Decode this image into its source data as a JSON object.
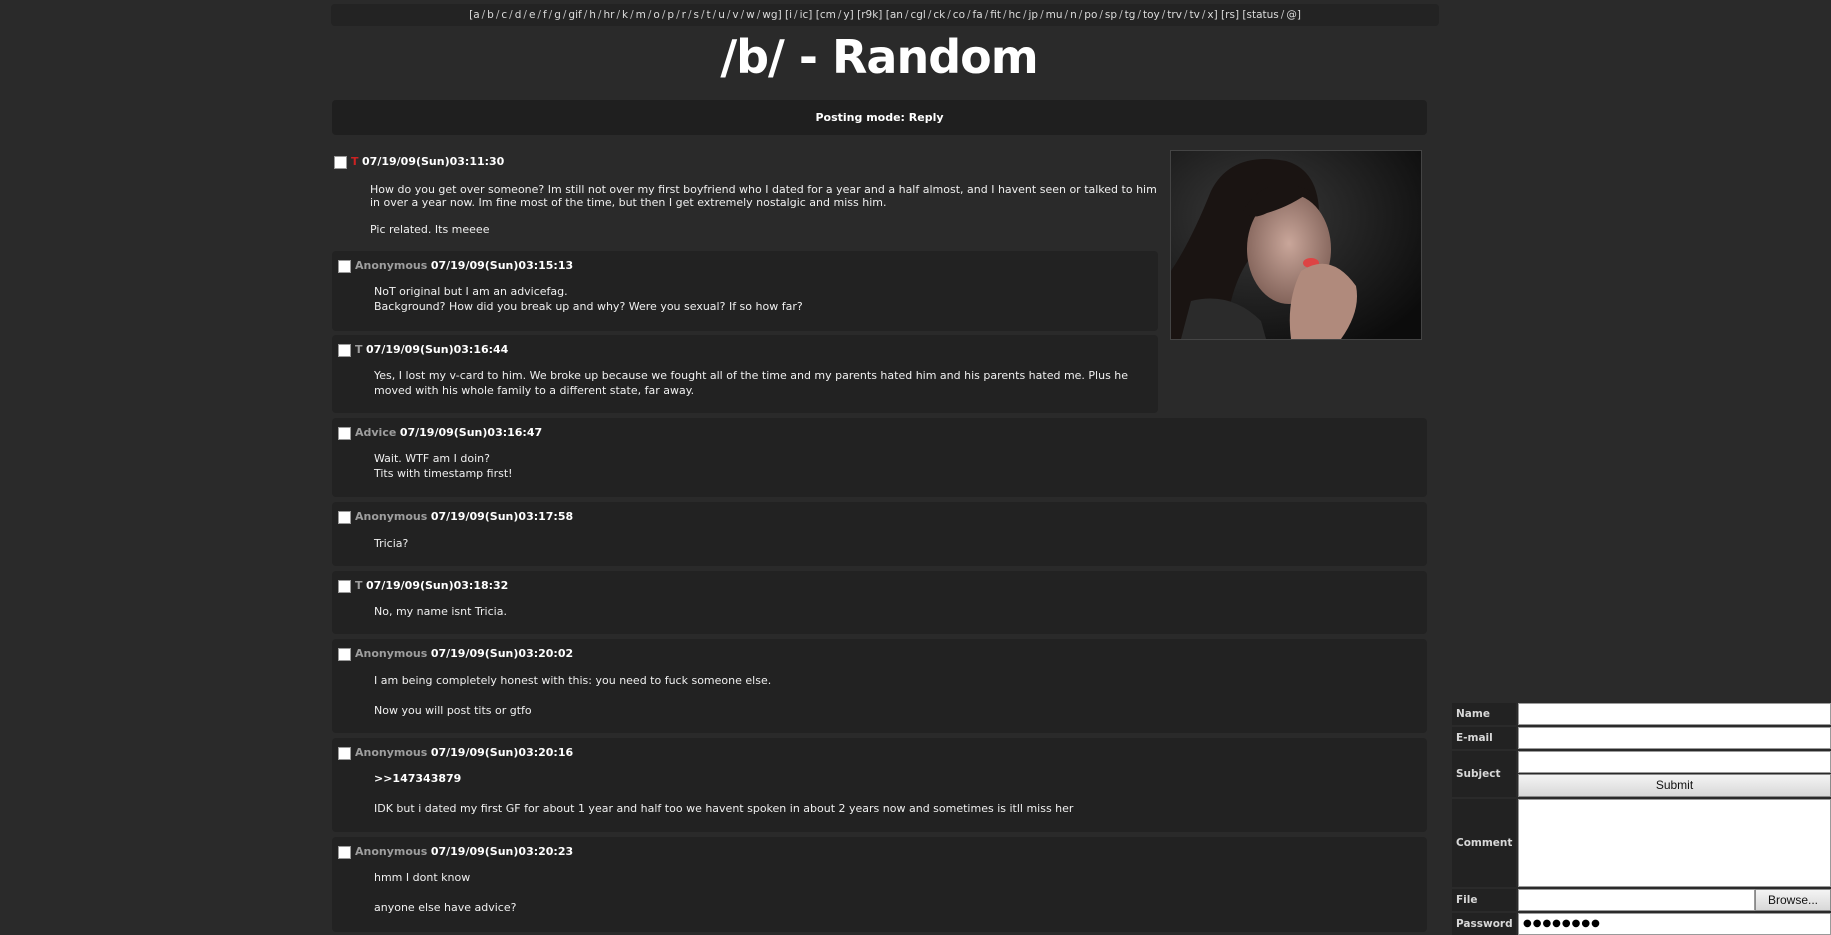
{
  "nav": {
    "groups": [
      [
        "a",
        "b",
        "c",
        "d",
        "e",
        "f",
        "g",
        "gif",
        "h",
        "hr",
        "k",
        "m",
        "o",
        "p",
        "r",
        "s",
        "t",
        "u",
        "v",
        "w",
        "wg"
      ],
      [
        "i",
        "ic"
      ],
      [
        "cm",
        "y"
      ],
      [
        "r9k"
      ],
      [
        "an",
        "cgl",
        "ck",
        "co",
        "fa",
        "fit",
        "hc",
        "jp",
        "mu",
        "n",
        "po",
        "sp",
        "tg",
        "toy",
        "trv",
        "tv",
        "x"
      ],
      [
        "rs"
      ],
      [
        "status",
        "@"
      ]
    ]
  },
  "board_title": "/b/ - Random",
  "posting_mode": "Posting mode: Reply",
  "op": {
    "name": "T",
    "timestamp": "07/19/09(Sun)03:11:30",
    "body_line1": "How do you get over someone? Im still not over my first boyfriend who I dated for a year and a half almost, and I havent seen or talked to him in over a year now. Im fine most of the time, but then I get extremely nostalgic and miss him.",
    "body_line2": "Pic related. Its meeee"
  },
  "replies": [
    {
      "name": "Anonymous",
      "timestamp": "07/19/09(Sun)03:15:13",
      "lines": [
        "NoT original but I am an advicefag.",
        "Background? How did you break up and why? Were you sexual? If so how far?"
      ]
    },
    {
      "name": "T",
      "timestamp": "07/19/09(Sun)03:16:44",
      "lines": [
        "Yes, I lost my v-card to him. We broke up because we fought all of the time and my parents hated him and his parents hated me. Plus he moved with his whole family to a different state, far away."
      ]
    },
    {
      "name": "Advice",
      "timestamp": "07/19/09(Sun)03:16:47",
      "lines": [
        "Wait. WTF am I doin?",
        "Tits with timestamp first!"
      ]
    },
    {
      "name": "Anonymous",
      "timestamp": "07/19/09(Sun)03:17:58",
      "lines": [
        "Tricia?"
      ]
    },
    {
      "name": "T",
      "timestamp": "07/19/09(Sun)03:18:32",
      "lines": [
        "No, my name isnt Tricia."
      ]
    },
    {
      "name": "Anonymous",
      "timestamp": "07/19/09(Sun)03:20:02",
      "lines": [
        "I am being completely honest with this: you need to fuck someone else.",
        "",
        "Now you will post tits or gtfo"
      ]
    },
    {
      "name": "Anonymous",
      "timestamp": "07/19/09(Sun)03:20:16",
      "quote": ">>147343879",
      "lines": [
        "IDK but i dated my first GF for about 1 year and half too we havent spoken in about 2 years now and sometimes is itll miss her"
      ]
    },
    {
      "name": "Anonymous",
      "timestamp": "07/19/09(Sun)03:20:23",
      "lines": [
        "hmm I dont know",
        "",
        "anyone else have advice?"
      ]
    }
  ],
  "form": {
    "name_label": "Name",
    "email_label": "E-mail",
    "subject_label": "Subject",
    "comment_label": "Comment",
    "file_label": "File",
    "password_label": "Password",
    "submit_label": "Submit",
    "browse_label": "Browse...",
    "password_value": "●●●●●●●●"
  },
  "colors": {
    "background": "#2a2a2a",
    "op_name": "#cc2222",
    "poster_name": "#9e9e9e"
  },
  "icons": [
    "checkbox",
    "op-photo"
  ]
}
